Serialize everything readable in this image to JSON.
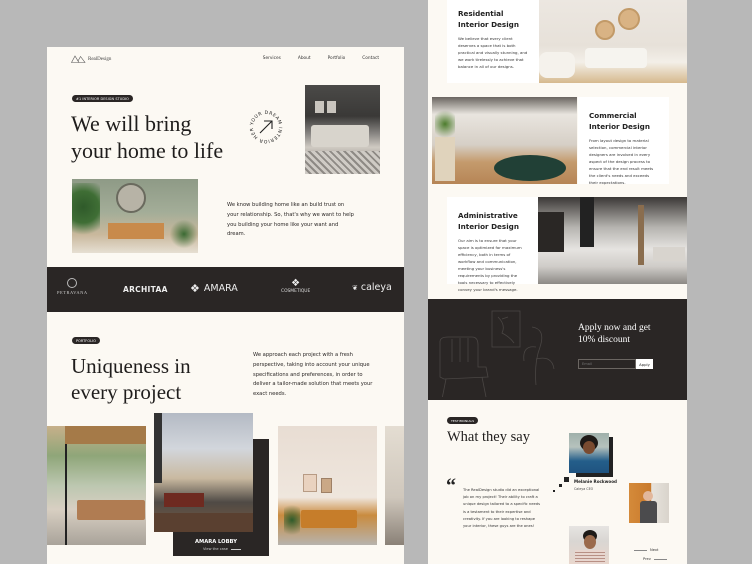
{
  "brand": {
    "name": "RealDesign"
  },
  "nav": {
    "items": [
      "Services",
      "About",
      "Portfolio",
      "Contact"
    ]
  },
  "hero": {
    "badge": "#1 INTERIOR DESIGN STUDIO",
    "title_line1": "We will bring",
    "title_line2": "your home to life",
    "circle_text": "YOUR DREAM INTERIOR HERE",
    "description": "We know building home like an build trust on your relationship. So, that's why we want to help you building your home like your want and dream."
  },
  "partners": [
    "PETRAVANA",
    "ARCHITAA",
    "AMARA",
    "COSMETIQUE",
    "caleya"
  ],
  "portfolio": {
    "badge": "PORTFOLIO",
    "title_line1": "Uniqueness in",
    "title_line2": "every project",
    "description": "We approach each project with a fresh perspective, taking into account your unique specifications and preferences, in order to deliver a tailor-made solution that meets your exact needs.",
    "featured": {
      "title": "AMARA LOBBY",
      "link": "View the case"
    }
  },
  "services": [
    {
      "title": "Residential Interior Design",
      "text": "We believe that every client deserves a space that is both practical and visually stunning, and we work tirelessly to achieve that balance in all of our designs."
    },
    {
      "title": "Commercial Interior Design",
      "text": "From layout design to material selection, commercial interior designers are involved in every aspect of the design process to ensure that the end result meets the client's needs and exceeds their expectations."
    },
    {
      "title": "Administrative Interior Design",
      "text": "Our aim is to ensure that your space is optimized for maximum efficiency, both in terms of workflow and communication, meeting your business's requirements by providing the tools necessary to effectively convey your brand's message."
    }
  ],
  "cta": {
    "title_line1": "Apply now and get",
    "title_line2": "10% discount",
    "email_placeholder": "Email",
    "button": "Apply"
  },
  "testimonials": {
    "badge": "TESTIMONIALS",
    "title": "What they say",
    "quote": "The RealDesign studio did an exceptional job on my project! Their ability to craft a unique design tailored to a specific needs is a testament to their expertise and creativity. If you are looking to reshape your interior, these guys are the ones!",
    "person_name": "Melanie Rockwood",
    "person_role": "Caleya CEO",
    "next": "Next",
    "prev": "Prev"
  },
  "colors": {
    "background": "#fcf9f3",
    "dark": "#2a2625",
    "frame": "#b8b8b8"
  }
}
